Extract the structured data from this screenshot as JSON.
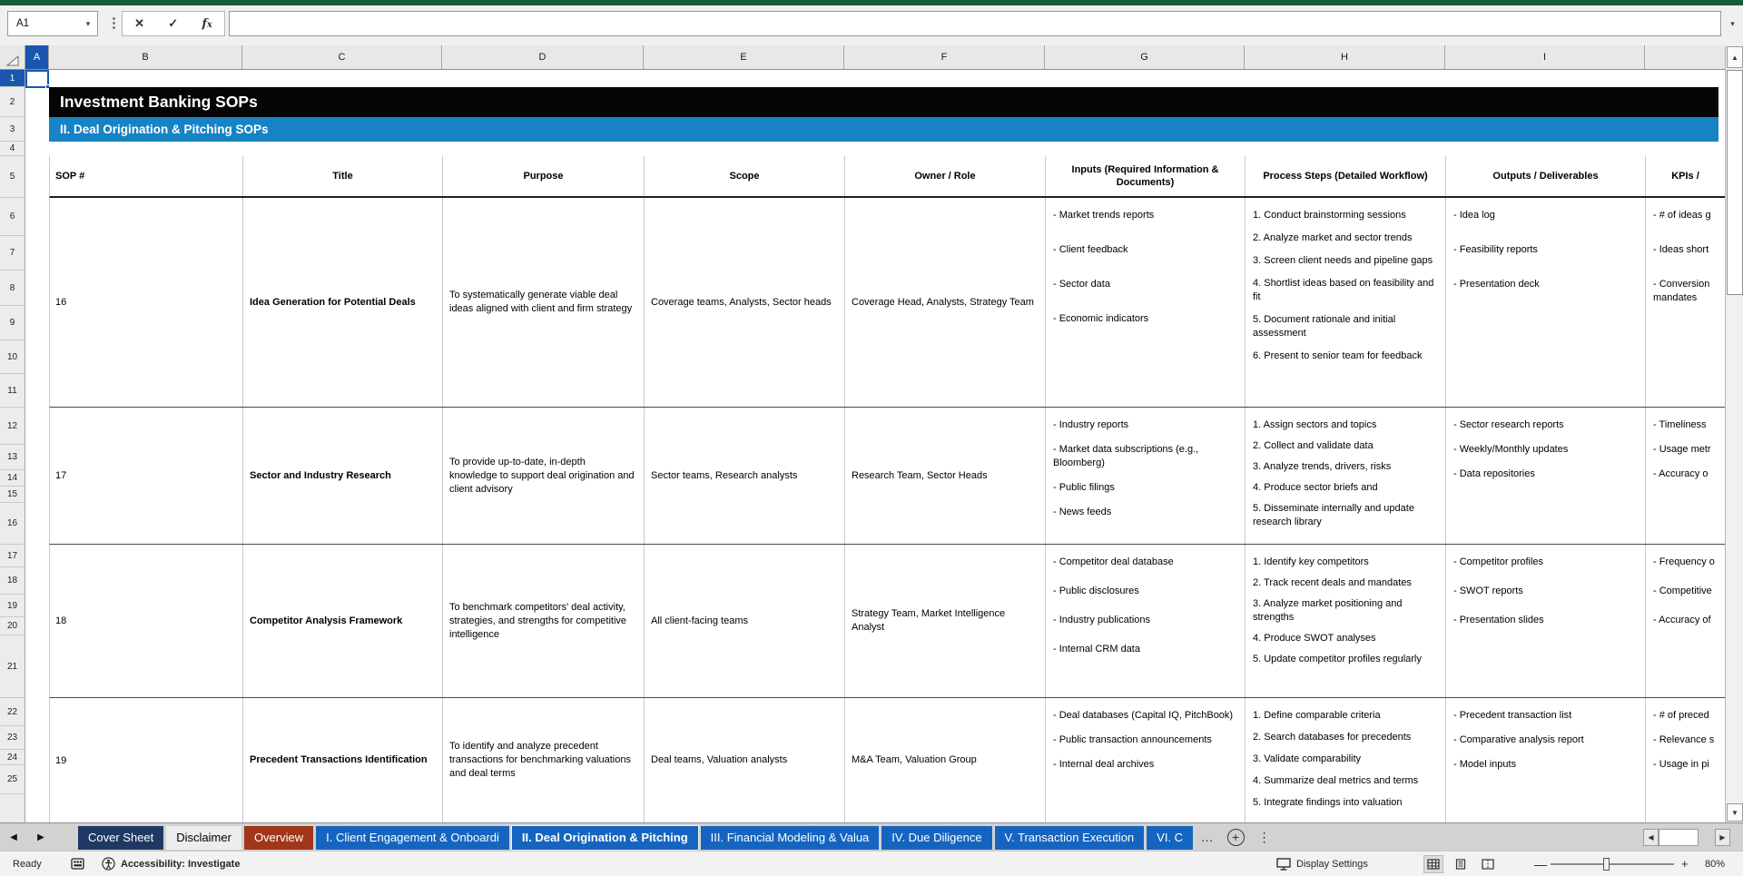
{
  "toolbar": {
    "name_box_value": "A1",
    "formula_value": ""
  },
  "icons": {
    "caret_down": "▾",
    "cancel": "✕",
    "accept": "✓",
    "tab_prev": "◀",
    "tab_next": "▶",
    "overflow": "…",
    "add_sheet": "+",
    "tab_menu": "⋮",
    "scroll_up": "▲",
    "scroll_down": "▼",
    "scroll_left": "◀",
    "scroll_right": "▶",
    "zoom_out": "—",
    "zoom_in": "+"
  },
  "grid": {
    "column_letters": [
      "A",
      "B",
      "C",
      "D",
      "E",
      "F",
      "G",
      "H",
      "I"
    ],
    "row_numbers": [
      "1",
      "2",
      "3",
      "4",
      "5",
      "6",
      "7",
      "8",
      "9",
      "10",
      "11",
      "12",
      "13",
      "14",
      "15",
      "16",
      "17",
      "18",
      "19",
      "20",
      "21",
      "22",
      "23",
      "24",
      "25"
    ]
  },
  "sheet": {
    "title_banner": "Investment Banking SOPs",
    "section_banner": "II. Deal Origination & Pitching SOPs",
    "headers": [
      "SOP #",
      "Title",
      "Purpose",
      "Scope",
      "Owner / Role",
      "Inputs (Required Information & Documents)",
      "Process Steps (Detailed Workflow)",
      "Outputs / Deliverables",
      "KPIs /"
    ],
    "rows": [
      {
        "sop": "16",
        "title": "Idea Generation for Potential Deals",
        "purpose": "To systematically generate viable deal ideas aligned with client and firm strategy",
        "scope": "Coverage teams, Analysts, Sector heads",
        "owner": "Coverage Head, Analysts, Strategy Team",
        "inputs": [
          "- Market trends reports",
          "- Client feedback",
          "- Sector data",
          "- Economic indicators"
        ],
        "steps": [
          "1. Conduct brainstorming sessions",
          "2. Analyze market and sector trends",
          "3. Screen client needs and pipeline gaps",
          "4. Shortlist ideas based on feasibility and fit",
          "5. Document rationale and initial assessment",
          "6. Present to senior team for feedback"
        ],
        "outputs": [
          "- Idea log",
          "- Feasibility reports",
          "- Presentation deck"
        ],
        "kpis": [
          "- # of ideas g",
          "- Ideas short",
          "- Conversion\nmandates"
        ]
      },
      {
        "sop": "17",
        "title": "Sector and Industry Research",
        "purpose": "To provide up-to-date, in-depth knowledge to support deal origination and client advisory",
        "scope": "Sector teams, Research analysts",
        "owner": "Research Team, Sector Heads",
        "inputs": [
          "- Industry reports",
          "- Market data subscriptions (e.g., Bloomberg)",
          "- Public filings",
          "- News feeds"
        ],
        "steps": [
          "1. Assign sectors and topics",
          "2. Collect and validate data",
          "3. Analyze trends, drivers, risks",
          "4. Produce sector briefs and",
          "5. Disseminate internally and update research library"
        ],
        "outputs": [
          "- Sector research reports",
          "- Weekly/Monthly updates",
          "- Data repositories"
        ],
        "kpis": [
          "- Timeliness",
          "- Usage metr",
          "- Accuracy o"
        ]
      },
      {
        "sop": "18",
        "title": "Competitor Analysis Framework",
        "purpose": "To benchmark competitors' deal activity, strategies, and strengths for competitive intelligence",
        "scope": "All client-facing teams",
        "owner": "Strategy Team, Market Intelligence Analyst",
        "inputs": [
          "- Competitor deal database",
          "- Public disclosures",
          "- Industry publications",
          "- Internal CRM data"
        ],
        "steps": [
          "1. Identify key competitors",
          "2. Track recent deals and mandates",
          "3. Analyze market positioning and strengths",
          "4. Produce SWOT analyses",
          "5. Update competitor profiles regularly"
        ],
        "outputs": [
          "- Competitor profiles",
          "- SWOT reports",
          "- Presentation slides"
        ],
        "kpis": [
          "- Frequency o",
          "- Competitive",
          "- Accuracy of"
        ]
      },
      {
        "sop": "19",
        "title": "Precedent Transactions Identification",
        "purpose": "To identify and analyze precedent transactions for benchmarking valuations and deal terms",
        "scope": "Deal teams, Valuation analysts",
        "owner": "M&A Team, Valuation Group",
        "inputs": [
          "- Deal databases (Capital IQ, PitchBook)",
          "- Public transaction announcements",
          "- Internal deal archives"
        ],
        "steps": [
          "1. Define comparable criteria",
          "2. Search databases for precedents",
          "3. Validate comparability",
          "4. Summarize deal metrics and terms",
          "5. Integrate findings into valuation"
        ],
        "outputs": [
          "- Precedent transaction list",
          "- Comparative analysis report",
          "- Model inputs"
        ],
        "kpis": [
          "- # of preced",
          "- Relevance s",
          "- Usage in pi"
        ]
      }
    ]
  },
  "tabbar": {
    "tabs": [
      {
        "label": "Cover Sheet",
        "color": "#1F3864",
        "fg": "#FFFFFF"
      },
      {
        "label": "Disclaimer",
        "color": "#EDEDED",
        "fg": "#000000"
      },
      {
        "label": "Overview",
        "color": "#A0371A",
        "fg": "#FFFFFF"
      },
      {
        "label": "I. Client Engagement & Onboardi",
        "color": "#1565C0",
        "fg": "#FFFFFF"
      },
      {
        "label": "II. Deal Origination & Pitching",
        "color": "#1565C0",
        "fg": "#FFFFFF",
        "active": true
      },
      {
        "label": "III. Financial Modeling & Valua",
        "color": "#1565C0",
        "fg": "#FFFFFF"
      },
      {
        "label": "IV. Due Diligence",
        "color": "#1565C0",
        "fg": "#FFFFFF"
      },
      {
        "label": "V. Transaction Execution",
        "color": "#1565C0",
        "fg": "#FFFFFF"
      },
      {
        "label": "VI. C",
        "color": "#1565C0",
        "fg": "#FFFFFF"
      }
    ],
    "overflow": "…"
  },
  "statusbar": {
    "ready": "Ready",
    "accessibility": "Accessibility: Investigate",
    "display_settings": "Display Settings",
    "zoom_label": "80%"
  },
  "colors": {
    "ribbon_green": "#185C37",
    "selection_blue": "#1A56B0",
    "banner_black": "#050505",
    "banner_blue": "#1783C4",
    "tab_blue": "#1565C0",
    "tab_navy": "#1F3864",
    "tab_red": "#A0371A",
    "active_tab_underline": "#0E7C3F"
  }
}
